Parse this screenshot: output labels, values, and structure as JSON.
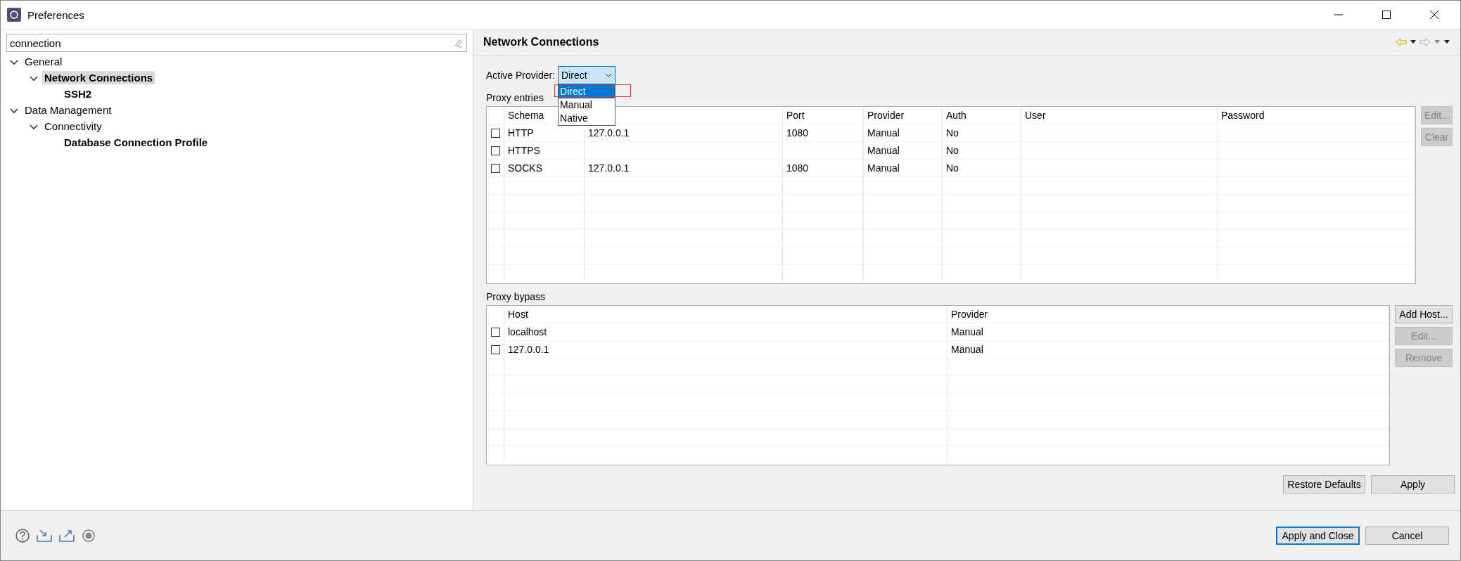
{
  "window": {
    "title": "Preferences"
  },
  "filter": {
    "value": "connection"
  },
  "tree": [
    {
      "label": "General",
      "expanded": true,
      "selected": false,
      "matched": false,
      "children": [
        {
          "label": "Network Connections",
          "expanded": true,
          "selected": true,
          "matched": true,
          "children": [
            {
              "label": "SSH2",
              "selected": false,
              "matched": true
            }
          ]
        }
      ]
    },
    {
      "label": "Data Management",
      "expanded": true,
      "selected": false,
      "matched": false,
      "children": [
        {
          "label": "Connectivity",
          "expanded": true,
          "selected": false,
          "matched": false,
          "children": [
            {
              "label": "Database Connection Profile",
              "selected": false,
              "matched": true
            }
          ]
        }
      ]
    }
  ],
  "page": {
    "title": "Network Connections"
  },
  "active_provider": {
    "label": "Active Provider:",
    "value": "Direct",
    "expanded": true,
    "options": [
      {
        "label": "Direct",
        "selected": true
      },
      {
        "label": "Manual",
        "selected": false
      },
      {
        "label": "Native",
        "selected": false
      }
    ]
  },
  "proxy_entries": {
    "label": "Proxy entries",
    "columns": [
      "Schema",
      null,
      "Port",
      "Provider",
      "Auth",
      "User",
      "Password"
    ],
    "rows": [
      {
        "checked": false,
        "cells": [
          "HTTP",
          "127.0.0.1",
          "1080",
          "Manual",
          "No",
          null,
          null
        ]
      },
      {
        "checked": false,
        "cells": [
          "HTTPS",
          null,
          null,
          "Manual",
          "No",
          null,
          null
        ]
      },
      {
        "checked": false,
        "cells": [
          "SOCKS",
          "127.0.0.1",
          "1080",
          "Manual",
          "No",
          null,
          null
        ]
      }
    ],
    "buttons": [
      {
        "label": "Edit...",
        "disabled": true
      },
      {
        "label": "Clear",
        "disabled": true
      }
    ]
  },
  "proxy_bypass": {
    "label": "Proxy bypass",
    "columns": [
      "Host",
      "Provider"
    ],
    "rows": [
      {
        "checked": false,
        "cells": [
          "localhost",
          "Manual"
        ]
      },
      {
        "checked": false,
        "cells": [
          "127.0.0.1",
          "Manual"
        ]
      }
    ],
    "buttons": [
      {
        "label": "Add Host...",
        "disabled": false
      },
      {
        "label": "Edit...",
        "disabled": true
      },
      {
        "label": "Remove",
        "disabled": true
      }
    ]
  },
  "page_buttons": [
    {
      "label": "Restore Defaults",
      "default": false
    },
    {
      "label": "Apply",
      "default": false
    }
  ],
  "dialog_buttons": [
    {
      "label": "Apply and Close",
      "default": true
    },
    {
      "label": "Cancel",
      "default": false
    }
  ]
}
